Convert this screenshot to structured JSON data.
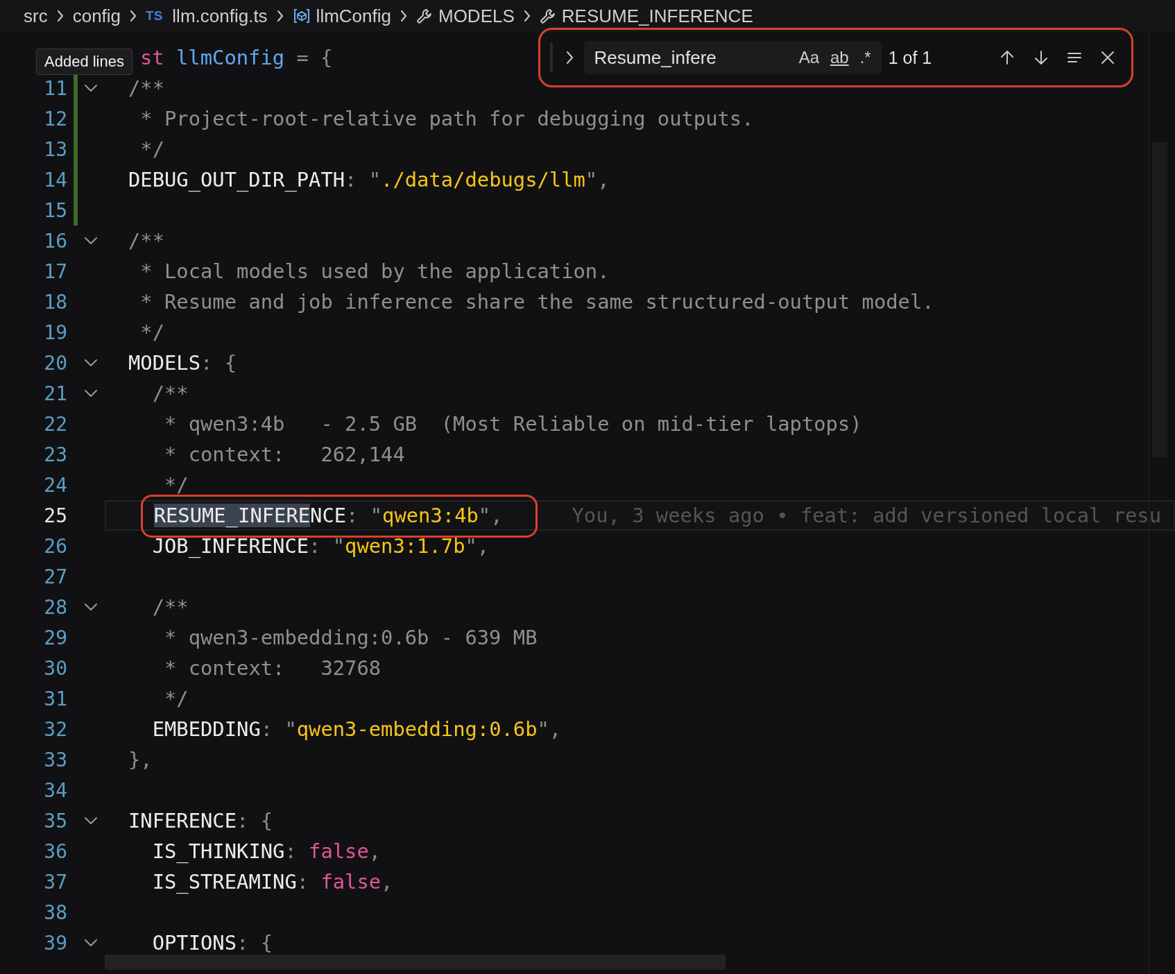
{
  "breadcrumbs": [
    {
      "text": "src",
      "kind": "folder"
    },
    {
      "text": "config",
      "kind": "folder"
    },
    {
      "text": "llm.config.ts",
      "kind": "file",
      "icon_text": "TS"
    },
    {
      "text": "llmConfig",
      "kind": "object"
    },
    {
      "text": "MODELS",
      "kind": "property"
    },
    {
      "text": "RESUME_INFERENCE",
      "kind": "property"
    }
  ],
  "tooltip": {
    "text": "Added lines"
  },
  "find_widget": {
    "expanded": false,
    "value": "Resume_infere",
    "options": [
      {
        "label": "Aa",
        "on": false
      },
      {
        "label": "ab",
        "on": false
      },
      {
        "label": ".*",
        "on": false
      }
    ],
    "count": "1 of 1",
    "outlined": true
  },
  "lines": [
    {
      "fold": false,
      "added": false,
      "current": false,
      "tokens": [
        {
          "kind": "keyword",
          "text": "st"
        },
        {
          "kind": "variable",
          "text": " llmConfig"
        },
        {
          "kind": "punct",
          "text": " = {"
        }
      ]
    },
    {
      "number": "11",
      "fold": true,
      "added": true,
      "current": false,
      "tokens": [
        {
          "kind": "comment",
          "text": "/**"
        }
      ]
    },
    {
      "number": "12",
      "fold": false,
      "added": true,
      "current": false,
      "tokens": [
        {
          "kind": "comment",
          "text": " * Project-root-relative path for debugging outputs."
        }
      ]
    },
    {
      "number": "13",
      "fold": false,
      "added": true,
      "current": false,
      "tokens": [
        {
          "kind": "comment",
          "text": " */"
        }
      ]
    },
    {
      "number": "14",
      "fold": false,
      "added": true,
      "current": false,
      "tokens": [
        {
          "kind": "key",
          "text": "DEBUG_OUT_DIR_PATH"
        },
        {
          "kind": "punct",
          "text": ": \""
        },
        {
          "kind": "string",
          "text": "./data/debugs/llm"
        },
        {
          "kind": "punct",
          "text": "\","
        }
      ]
    },
    {
      "number": "15",
      "fold": false,
      "added": true,
      "current": false
    },
    {
      "number": "16",
      "fold": true,
      "added": false,
      "current": false,
      "tokens": [
        {
          "kind": "comment",
          "text": "/**"
        }
      ]
    },
    {
      "number": "17",
      "fold": false,
      "added": false,
      "current": false,
      "tokens": [
        {
          "kind": "comment",
          "text": " * Local models used by the application."
        }
      ]
    },
    {
      "number": "18",
      "fold": false,
      "added": false,
      "current": false,
      "tokens": [
        {
          "kind": "comment",
          "text": " * Resume and job inference share the same structured-output model."
        }
      ]
    },
    {
      "number": "19",
      "fold": false,
      "added": false,
      "current": false,
      "tokens": [
        {
          "kind": "comment",
          "text": " */"
        }
      ]
    },
    {
      "number": "20",
      "fold": true,
      "added": false,
      "current": false,
      "tokens": [
        {
          "kind": "key",
          "text": "MODELS"
        },
        {
          "kind": "punct",
          "text": ": {"
        }
      ]
    },
    {
      "number": "21",
      "fold": true,
      "added": false,
      "current": false,
      "tokens": [
        {
          "kind": "comment",
          "text": "  /**"
        }
      ]
    },
    {
      "number": "22",
      "fold": false,
      "added": false,
      "current": false,
      "tokens": [
        {
          "kind": "comment",
          "text": "   * qwen3:4b   - 2.5 GB  (Most Reliable on mid-tier laptops)"
        }
      ]
    },
    {
      "number": "23",
      "fold": false,
      "added": false,
      "current": false,
      "tokens": [
        {
          "kind": "comment",
          "text": "   * context:   262,144"
        }
      ]
    },
    {
      "number": "24",
      "fold": false,
      "added": false,
      "current": false,
      "tokens": [
        {
          "kind": "comment",
          "text": "   */"
        }
      ]
    },
    {
      "number": "25",
      "fold": false,
      "added": false,
      "current": true,
      "outlined": true,
      "blame": "You, 3 weeks ago • feat: add versioned local resu",
      "tokens": [
        {
          "kind": "key-match",
          "text": "  RESUME_INFERE"
        },
        {
          "kind": "key",
          "text": "NCE"
        },
        {
          "kind": "punct",
          "text": ": \""
        },
        {
          "kind": "string",
          "text": "qwen3:4b"
        },
        {
          "kind": "punct",
          "text": "\","
        }
      ]
    },
    {
      "number": "26",
      "fold": false,
      "added": false,
      "current": false,
      "tokens": [
        {
          "kind": "key",
          "text": "  JOB_INFERENCE"
        },
        {
          "kind": "punct",
          "text": ": \""
        },
        {
          "kind": "string",
          "text": "qwen3:1.7b"
        },
        {
          "kind": "punct",
          "text": "\","
        }
      ]
    },
    {
      "number": "27",
      "fold": false,
      "added": false,
      "current": false
    },
    {
      "number": "28",
      "fold": true,
      "added": false,
      "current": false,
      "tokens": [
        {
          "kind": "comment",
          "text": "  /**"
        }
      ]
    },
    {
      "number": "29",
      "fold": false,
      "added": false,
      "current": false,
      "tokens": [
        {
          "kind": "comment",
          "text": "   * qwen3-embedding:0.6b - 639 MB"
        }
      ]
    },
    {
      "number": "30",
      "fold": false,
      "added": false,
      "current": false,
      "tokens": [
        {
          "kind": "comment",
          "text": "   * context:   32768"
        }
      ]
    },
    {
      "number": "31",
      "fold": false,
      "added": false,
      "current": false,
      "tokens": [
        {
          "kind": "comment",
          "text": "   */"
        }
      ]
    },
    {
      "number": "32",
      "fold": false,
      "added": false,
      "current": false,
      "tokens": [
        {
          "kind": "key",
          "text": "  EMBEDDING"
        },
        {
          "kind": "punct",
          "text": ": \""
        },
        {
          "kind": "string",
          "text": "qwen3-embedding:0.6b"
        },
        {
          "kind": "punct",
          "text": "\","
        }
      ]
    },
    {
      "number": "33",
      "fold": false,
      "added": false,
      "current": false,
      "tokens": [
        {
          "kind": "punct",
          "text": "},"
        }
      ]
    },
    {
      "number": "34",
      "fold": false,
      "added": false,
      "current": false
    },
    {
      "number": "35",
      "fold": true,
      "added": false,
      "current": false,
      "tokens": [
        {
          "kind": "key",
          "text": "INFERENCE"
        },
        {
          "kind": "punct",
          "text": ": {"
        }
      ]
    },
    {
      "number": "36",
      "fold": false,
      "added": false,
      "current": false,
      "tokens": [
        {
          "kind": "key",
          "text": "  IS_THINKING"
        },
        {
          "kind": "punct",
          "text": ": "
        },
        {
          "kind": "boolean",
          "text": "false"
        },
        {
          "kind": "punct",
          "text": ","
        }
      ]
    },
    {
      "number": "37",
      "fold": false,
      "added": false,
      "current": false,
      "tokens": [
        {
          "kind": "key",
          "text": "  IS_STREAMING"
        },
        {
          "kind": "punct",
          "text": ": "
        },
        {
          "kind": "boolean",
          "text": "false"
        },
        {
          "kind": "punct",
          "text": ","
        }
      ]
    },
    {
      "number": "38",
      "fold": false,
      "added": false,
      "current": false
    },
    {
      "number": "39",
      "fold": true,
      "added": false,
      "current": false,
      "tokens": [
        {
          "kind": "key",
          "text": "  OPTIONS"
        },
        {
          "kind": "punct",
          "text": ": {"
        }
      ]
    }
  ]
}
